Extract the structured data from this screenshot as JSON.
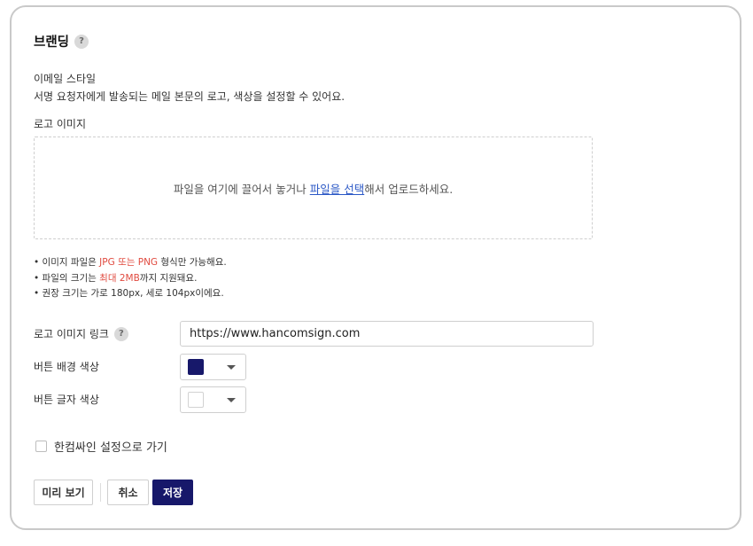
{
  "branding": {
    "title": "브랜딩",
    "help_icon": "?"
  },
  "email_style": {
    "heading": "이메일 스타일",
    "description": "서명 요청자에게 발송되는 메일 본문의 로고, 색상을 설정할 수 있어요."
  },
  "logo_image": {
    "label": "로고 이미지",
    "dropzone_text_before": "파일을 여기에 끌어서 놓거나 ",
    "dropzone_link": "파일을 선택",
    "dropzone_text_after": "해서 업로드하세요."
  },
  "notes": [
    {
      "prefix": "• 이미지 파일은 ",
      "highlight": "JPG 또는 PNG",
      "suffix": " 형식만 가능해요."
    },
    {
      "prefix": "• 파일의 크기는 ",
      "highlight": "최대 2MB",
      "suffix": "까지 지원돼요."
    },
    {
      "prefix": "• 권장 크기는 가로 180px, 세로 104px이에요.",
      "highlight": "",
      "suffix": ""
    }
  ],
  "form": {
    "logo_link_label": "로고 이미지 링크",
    "logo_link_value": "https://www.hancomsign.com",
    "button_bg_label": "버튼 배경 색상",
    "button_bg_color": "#17186a",
    "button_text_label": "버튼 글자 색상",
    "button_text_color": "#ffffff"
  },
  "checkbox": {
    "label": "한컴싸인 설정으로 가기",
    "checked": false
  },
  "buttons": {
    "preview": "미리 보기",
    "cancel": "취소",
    "save": "저장"
  },
  "colors": {
    "primary": "#17186a",
    "highlight_red": "#e04a3f",
    "link_blue": "#2b58c6"
  }
}
